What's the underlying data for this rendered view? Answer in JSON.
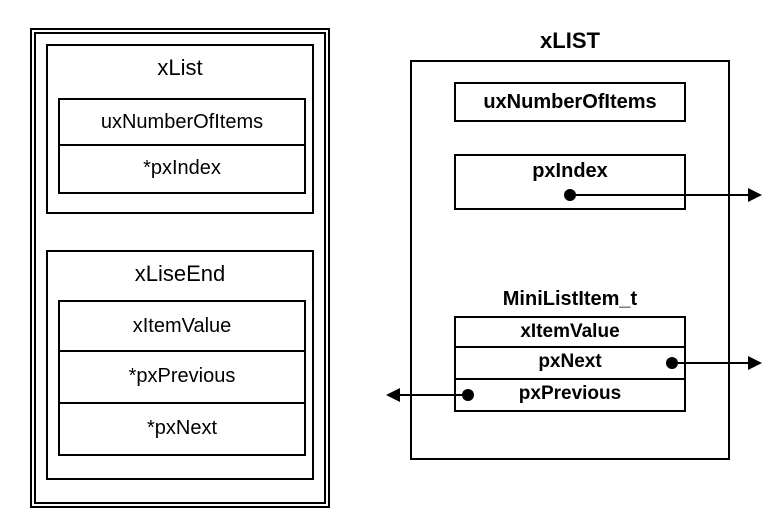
{
  "left": {
    "xList": {
      "title": "xList",
      "rows": [
        "uxNumberOfItems",
        "*pxIndex"
      ]
    },
    "xLiseEnd": {
      "title": "xLiseEnd",
      "rows": [
        "xItemValue",
        "*pxPrevious",
        "*pxNext"
      ]
    }
  },
  "right": {
    "title": "xLIST",
    "uxNumberOfItems": "uxNumberOfItems",
    "pxIndex": "pxIndex",
    "mini": {
      "title": "MiniListItem_t",
      "rows": [
        "xItemValue",
        "pxNext",
        "pxPrevious"
      ]
    }
  }
}
